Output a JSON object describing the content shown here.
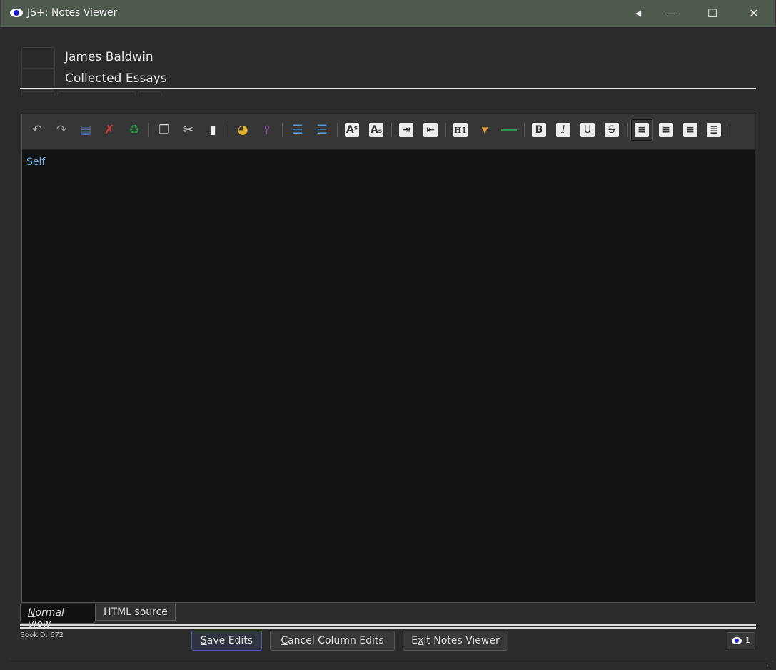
{
  "window": {
    "title": "JS+:  Notes Viewer"
  },
  "header": {
    "author": "James Baldwin",
    "title": "Collected Essays"
  },
  "toolbar": {
    "items": [
      "undo",
      "redo",
      "new-document",
      "clear-format",
      "recycle",
      "copy",
      "cut",
      "paste",
      "fill-color",
      "text-color",
      "ordered-list",
      "unordered-list",
      "superscript",
      "subscript",
      "indent",
      "outdent",
      "heading-1",
      "insert-block",
      "horizontal-rule",
      "bold",
      "italic",
      "underline",
      "strikethrough",
      "align-left",
      "align-center",
      "align-right",
      "align-justify"
    ],
    "h1_label": "H1",
    "active": "align-left"
  },
  "editor": {
    "content": "Self"
  },
  "tabs": {
    "normal_first": "N",
    "normal_rest": "ormal view",
    "html_first": "H",
    "html_rest": "TML source"
  },
  "footer": {
    "book_id": "BookID: 672",
    "save_first": "S",
    "save_rest": "ave Edits",
    "cancel_first": "C",
    "cancel_rest": "ancel Column Edits",
    "exit_pre": "E",
    "exit_u": "x",
    "exit_rest": "it Notes Viewer",
    "viewer_count": "1"
  }
}
